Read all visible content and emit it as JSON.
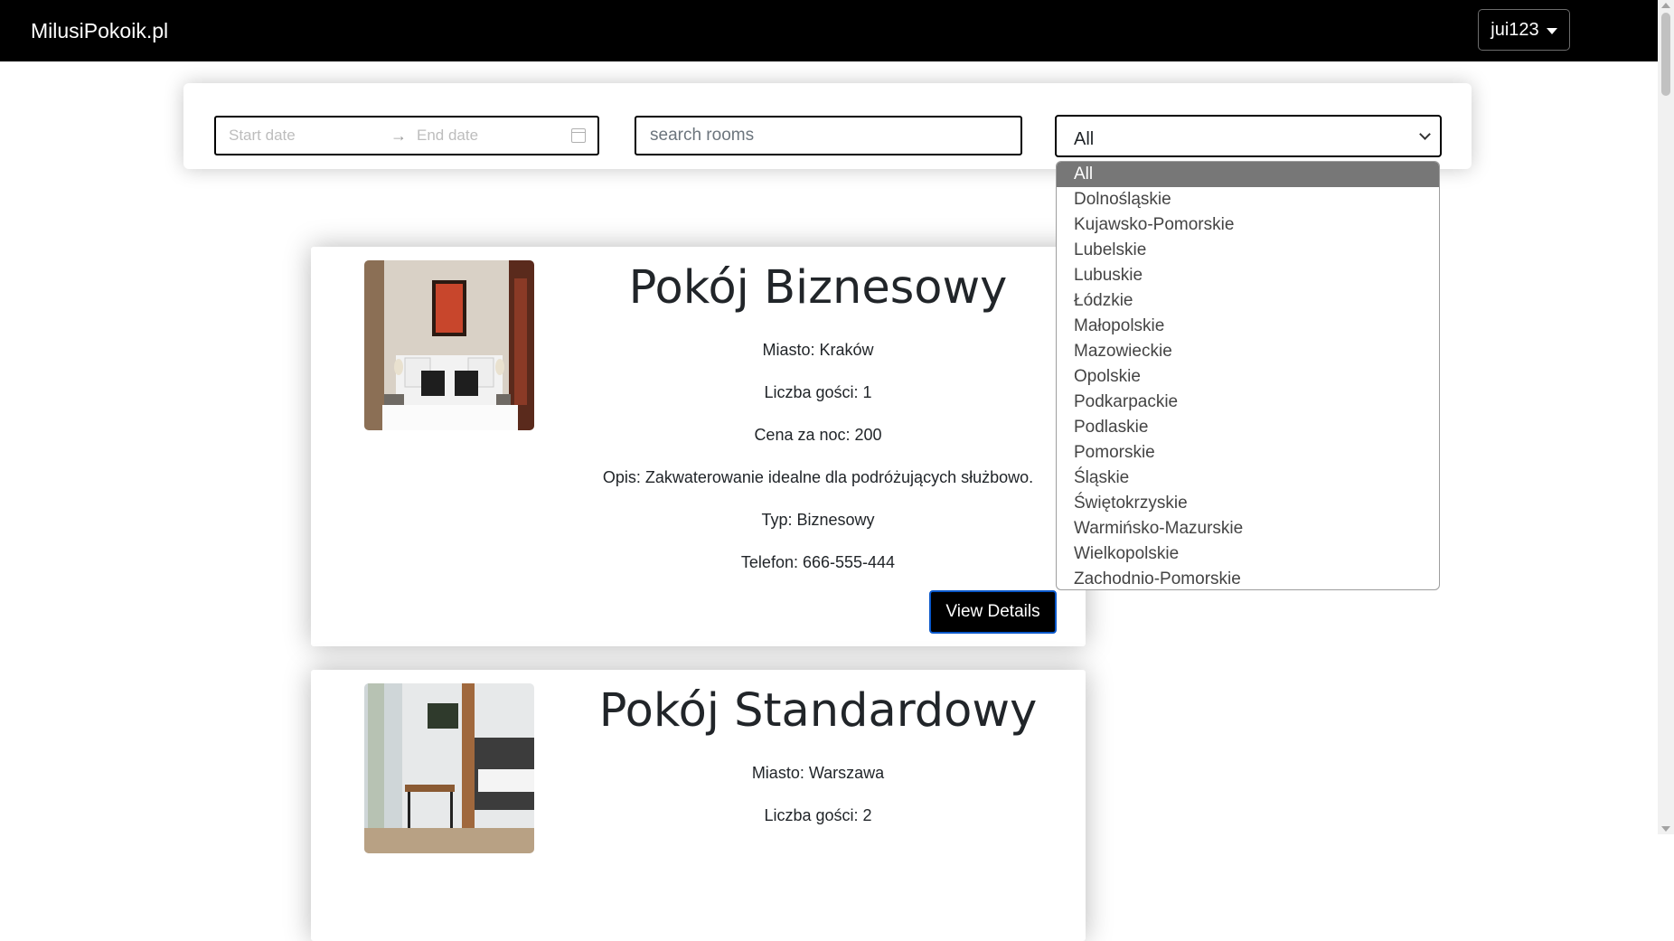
{
  "navbar": {
    "brand": "MilusiPokoik.pl",
    "user_label": "jui123"
  },
  "search": {
    "start_date_placeholder": "Start date",
    "end_date_placeholder": "End date",
    "search_placeholder": "search rooms",
    "region_selected": "All",
    "region_options": [
      "All",
      "Dolnośląskie",
      "Kujawsko-Pomorskie",
      "Lubelskie",
      "Lubuskie",
      "Łódzkie",
      "Małopolskie",
      "Mazowieckie",
      "Opolskie",
      "Podkarpackie",
      "Podlaskie",
      "Pomorskie",
      "Śląskie",
      "Świętokrzyskie",
      "Warmińsko-Mazurskie",
      "Wielkopolskie",
      "Zachodnio-Pomorskie"
    ]
  },
  "rooms": [
    {
      "title": "Pokój Biznesowy",
      "city": "Miasto: Kraków",
      "guests": "Liczba gości: 1",
      "price": "Cena za noc: 200",
      "description": "Opis: Zakwaterowanie idealne dla podróżujących służbowo.",
      "type": "Typ: Biznesowy",
      "phone": "Telefon: 666-555-444",
      "button_label": "View Details"
    },
    {
      "title": "Pokój Standardowy",
      "city": "Miasto: Warszawa",
      "guests": "Liczba gości: 2"
    }
  ],
  "colors": {
    "navbar_bg": "#000000",
    "button_bg": "#000000",
    "button_border": "#0a58ca",
    "selected_option_bg": "#777777"
  }
}
